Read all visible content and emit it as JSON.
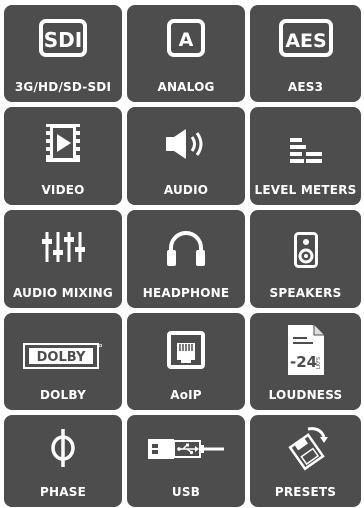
{
  "tiles": [
    {
      "label": "3G/HD/SD-SDI",
      "icon": "sdi-icon",
      "icon_text": "SDI"
    },
    {
      "label": "ANALOG",
      "icon": "analog-icon",
      "icon_text": "A"
    },
    {
      "label": "AES3",
      "icon": "aes-icon",
      "icon_text": "AES"
    },
    {
      "label": "VIDEO",
      "icon": "video-play-icon"
    },
    {
      "label": "AUDIO",
      "icon": "speaker-icon"
    },
    {
      "label": "LEVEL METERS",
      "icon": "level-meters-icon"
    },
    {
      "label": "AUDIO MIXING",
      "icon": "mixer-faders-icon"
    },
    {
      "label": "HEADPHONE",
      "icon": "headphone-icon"
    },
    {
      "label": "SPEAKERS",
      "icon": "loudspeaker-icon"
    },
    {
      "label": "DOLBY",
      "icon": "dolby-logo-icon",
      "icon_text": "DOLBY"
    },
    {
      "label": "AoIP",
      "icon": "ethernet-port-icon"
    },
    {
      "label": "LOUDNESS",
      "icon": "lkfs-document-icon",
      "icon_text": "-24",
      "icon_subtext": "LKFS"
    },
    {
      "label": "PHASE",
      "icon": "phase-icon",
      "icon_text": "Φ"
    },
    {
      "label": "USB",
      "icon": "usb-icon"
    },
    {
      "label": "PRESETS",
      "icon": "presets-icon"
    }
  ],
  "colors": {
    "tile": "#4d4d4d",
    "foreground": "#ffffff",
    "background": "#ffffff"
  }
}
